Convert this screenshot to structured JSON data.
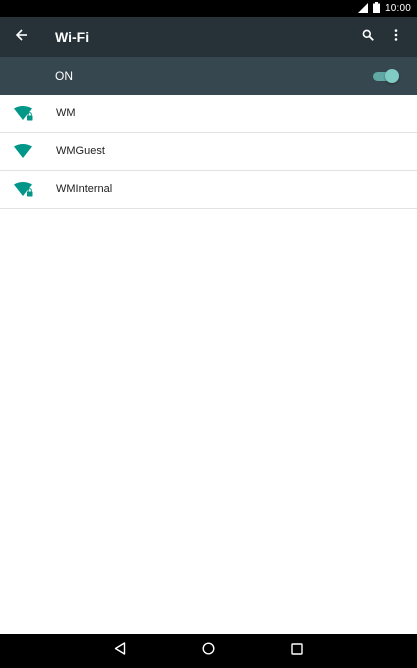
{
  "status_bar": {
    "time": "10:00",
    "icons": [
      "cell-signal-icon",
      "battery-icon"
    ]
  },
  "app_bar": {
    "title": "Wi-Fi",
    "icons": [
      "back-arrow-icon",
      "search-icon",
      "more-vert-icon"
    ]
  },
  "wifi_switch": {
    "label": "ON",
    "enabled": true
  },
  "networks": [
    {
      "name": "WM",
      "secured": true
    },
    {
      "name": "WMGuest",
      "secured": false
    },
    {
      "name": "WMInternal",
      "secured": true
    }
  ],
  "nav_bar": {
    "icons": [
      "back-triangle-icon",
      "home-circle-icon",
      "recents-square-icon"
    ]
  },
  "colors": {
    "app_bar": "#263238",
    "switch_row": "#37474f",
    "accent": "#009688",
    "toggle_thumb": "#80cbc4",
    "text_primary": "#212121",
    "divider": "#e2e2e2"
  }
}
